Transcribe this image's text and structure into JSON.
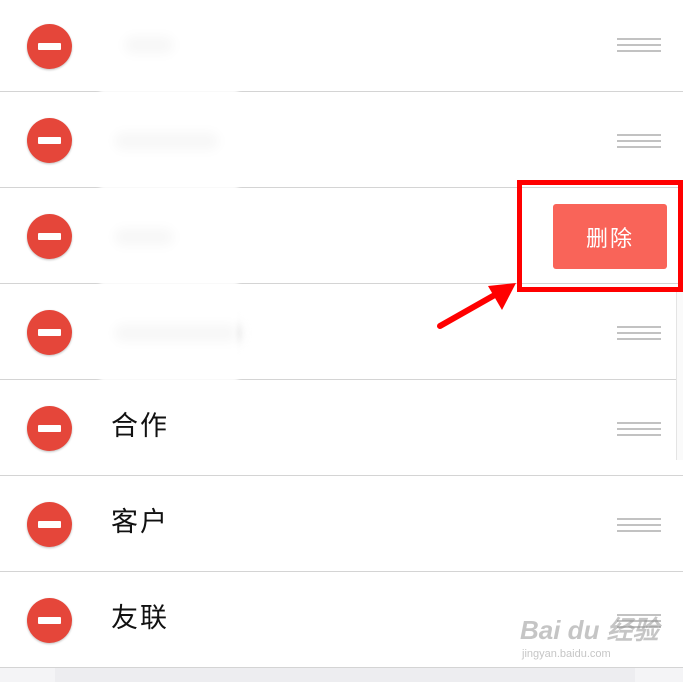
{
  "list": {
    "rows": [
      {
        "label": ""
      },
      {
        "label": ""
      },
      {
        "label": ""
      },
      {
        "label": ""
      },
      {
        "label": "合作"
      },
      {
        "label": "客户"
      },
      {
        "label": "友联"
      }
    ]
  },
  "swipe_action": {
    "delete_label": "删除"
  },
  "annotation": {
    "highlight_color": "#ff0000",
    "arrow_color": "#ff0000"
  },
  "watermark": {
    "mark_text": "Bai du 经验",
    "url_text": "jingyan.baidu.com"
  },
  "colors": {
    "remove_button": "#e5463a",
    "delete_button": "#f96459",
    "divider": "#d4d4d4",
    "drag_handle": "#c2c2c2"
  },
  "icons": {
    "remove": "minus-circle-icon",
    "reorder": "drag-handle-icon",
    "annotation_arrow": "arrow-icon"
  }
}
